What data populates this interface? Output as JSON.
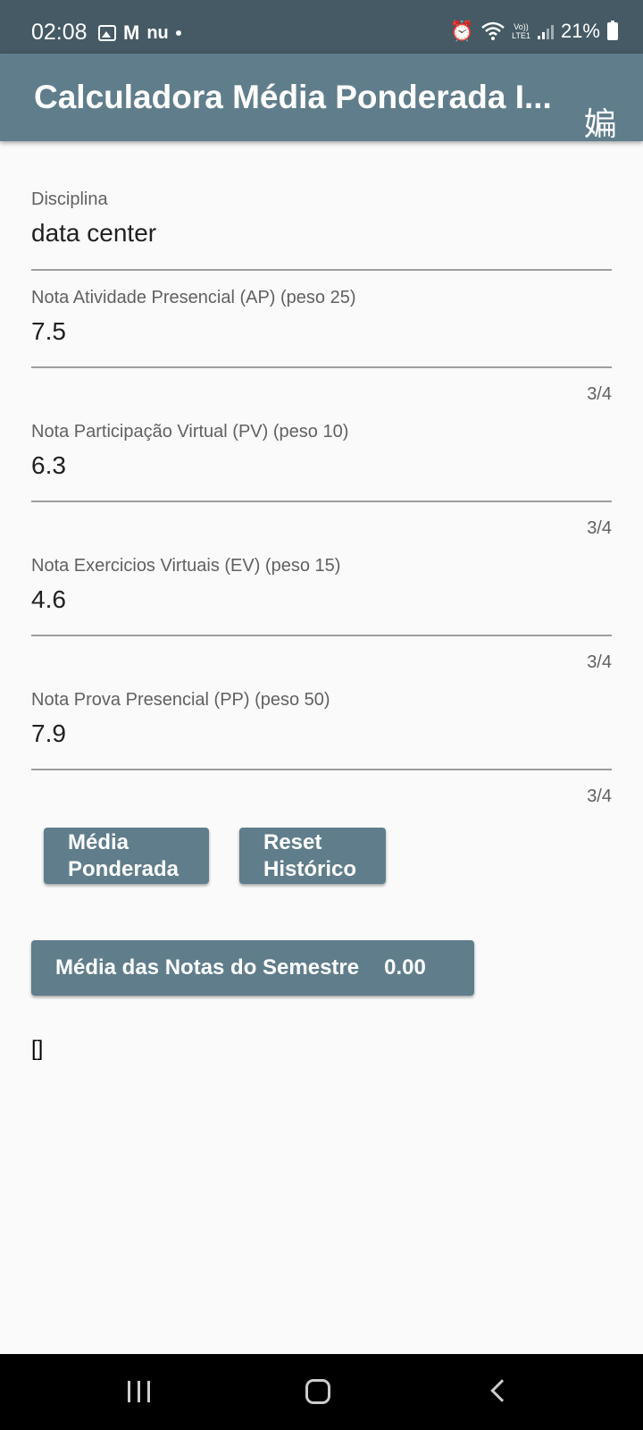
{
  "status_bar": {
    "time": "02:08",
    "carrier_icon_text": "nu",
    "battery": "21%",
    "net_top": "Vo))",
    "net_bottom": "LTE1"
  },
  "app_bar": {
    "title": "Calculadora Média Ponderada I...",
    "lang_glyph": "媥"
  },
  "form": {
    "disciplina": {
      "label": "Disciplina",
      "value": "data center"
    },
    "ap": {
      "label": "Nota Atividade Presencial (AP) (peso 25)",
      "value": "7.5",
      "counter": "3/4"
    },
    "pv": {
      "label": "Nota Participação Virtual (PV) (peso 10)",
      "value": "6.3",
      "counter": "3/4"
    },
    "ev": {
      "label": "Nota Exercicios Virtuais (EV) (peso 15)",
      "value": "4.6",
      "counter": "3/4"
    },
    "pp": {
      "label": "Nota Prova Presencial (PP) (peso 50)",
      "value": "7.9",
      "counter": "3/4"
    }
  },
  "buttons": {
    "media_line1": "Média",
    "media_line2": "Ponderada",
    "reset_line1": "Reset",
    "reset_line2": "Histórico"
  },
  "result": {
    "label": "Média das Notas do Semestre",
    "value": "0.00"
  },
  "history": "[]"
}
